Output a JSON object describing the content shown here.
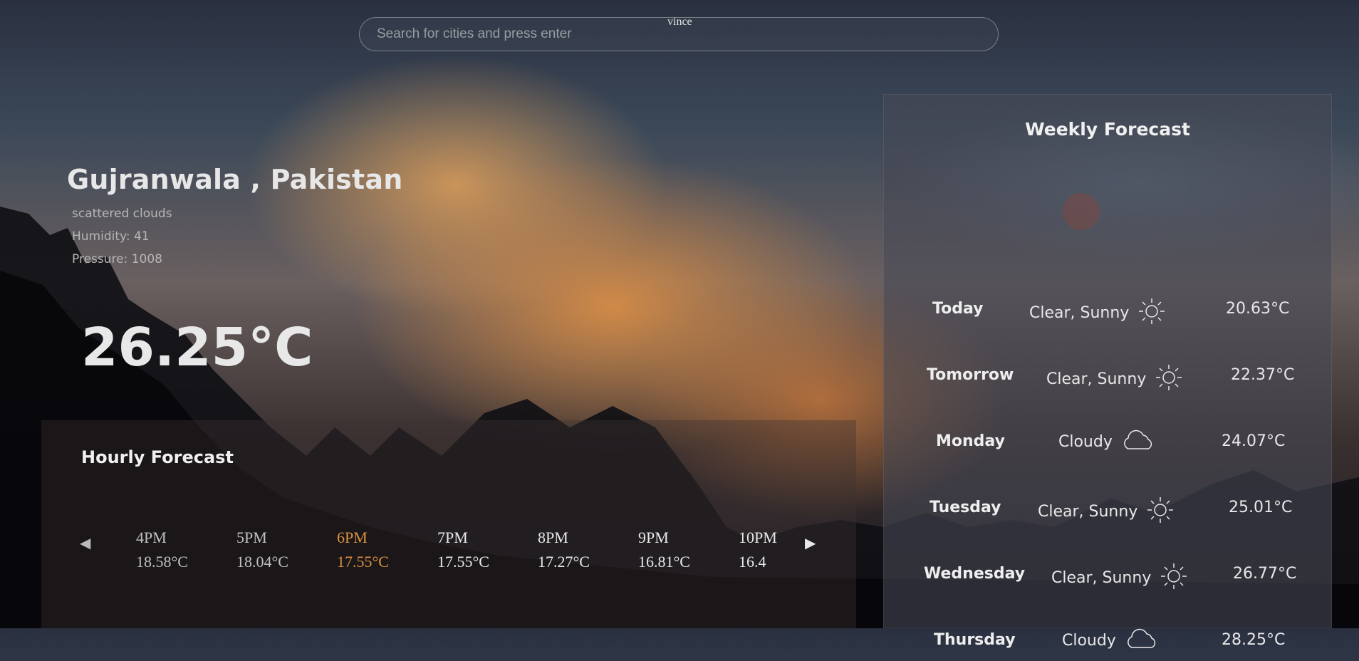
{
  "search": {
    "placeholder": "Search for cities and press enter",
    "hint": "vince"
  },
  "current": {
    "location": "Gujranwala , Pakistan",
    "description": "scattered clouds",
    "humidity": "Humidity: 41",
    "pressure": "Pressure: 1008",
    "temperature": "26.25°C"
  },
  "hourly": {
    "title": "Hourly Forecast",
    "prev_icon": "chevron-left-icon",
    "next_icon": "chevron-right-icon",
    "hours": [
      {
        "time": "4PM",
        "temp": "18.58°C"
      },
      {
        "time": "5PM",
        "temp": "18.04°C"
      },
      {
        "time": "6PM",
        "temp": "17.55°C"
      },
      {
        "time": "7PM",
        "temp": "17.55°C"
      },
      {
        "time": "8PM",
        "temp": "17.27°C"
      },
      {
        "time": "9PM",
        "temp": "16.81°C"
      },
      {
        "time": "10PM",
        "temp": "16.4"
      }
    ],
    "active_color": "#d9913f"
  },
  "weekly": {
    "title": "Weekly Forecast",
    "days": [
      {
        "day": "Today",
        "condition": "Clear, Sunny",
        "icon": "sun-icon",
        "temp": "20.63°C"
      },
      {
        "day": "Tomorrow",
        "condition": "Clear, Sunny",
        "icon": "sun-icon",
        "temp": "22.37°C"
      },
      {
        "day": "Monday",
        "condition": "Cloudy",
        "icon": "cloud-icon",
        "temp": "24.07°C"
      },
      {
        "day": "Tuesday",
        "condition": "Clear, Sunny",
        "icon": "sun-icon",
        "temp": "25.01°C"
      },
      {
        "day": "Wednesday",
        "condition": "Clear, Sunny",
        "icon": "sun-icon",
        "temp": "26.77°C"
      },
      {
        "day": "Thursday",
        "condition": "Cloudy",
        "icon": "cloud-icon",
        "temp": "28.25°C"
      }
    ]
  }
}
